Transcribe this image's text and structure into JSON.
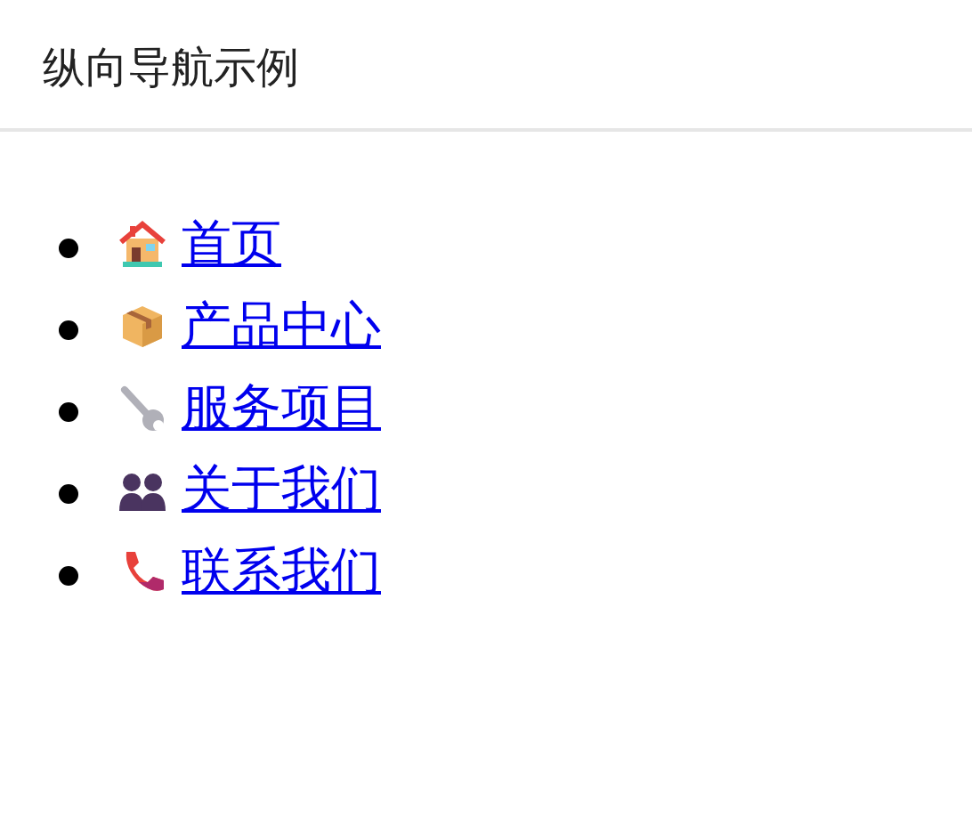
{
  "header": {
    "title": "纵向导航示例"
  },
  "nav": {
    "items": [
      {
        "label": "首页"
      },
      {
        "label": "产品中心"
      },
      {
        "label": "服务项目"
      },
      {
        "label": "关于我们"
      },
      {
        "label": "联系我们"
      }
    ]
  }
}
